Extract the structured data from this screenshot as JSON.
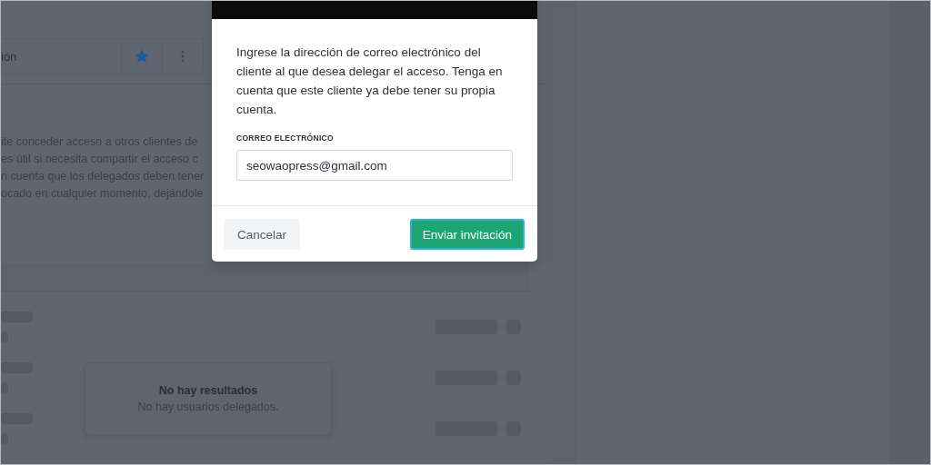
{
  "background": {
    "card_row": {
      "label": "ión",
      "starred": true
    },
    "description_lines": [
      "ite conceder acceso a otros clientes de",
      "es útil si necesita compartir el acceso c",
      "n cuenta que los delegados deben tener",
      "ocado en cualquier momento, dejándole"
    ],
    "empty_state": {
      "title": "No hay resultados",
      "message": "No hay usuarios delegados."
    }
  },
  "modal": {
    "description": "Ingrese la dirección de correo electrónico del cliente al que desea delegar el acceso. Tenga en cuenta que este cliente ya debe tener su propia cuenta.",
    "field": {
      "label": "CORREO ELECTRÓNICO",
      "value": "seowaopress@gmail.com"
    },
    "buttons": [
      {
        "label": "Cancelar",
        "kind": "secondary"
      },
      {
        "label": "Enviar invitación",
        "kind": "primary"
      }
    ]
  }
}
